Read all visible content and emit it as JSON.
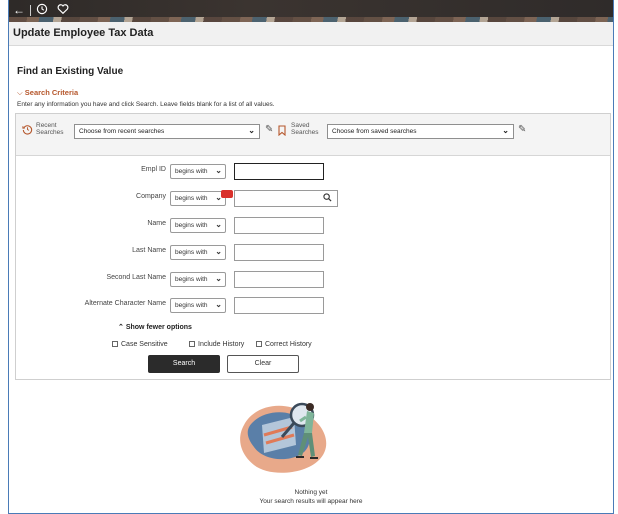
{
  "topbar": {
    "back_icon": "back-arrow-icon",
    "history_icon": "recent-history-icon",
    "favorite_icon": "heart-icon"
  },
  "page": {
    "title": "Update Employee Tax Data",
    "heading": "Find an Existing Value"
  },
  "criteria": {
    "toggle_label": "Search Criteria",
    "instructions": "Enter any information you have and click Search. Leave fields blank for a list of all values."
  },
  "recent": {
    "label_line1": "Recent",
    "label_line2": "Searches",
    "placeholder": "Choose from recent searches"
  },
  "saved": {
    "label_line1": "Saved",
    "label_line2": "Searches",
    "placeholder": "Choose from saved searches"
  },
  "fields": [
    {
      "label": "Empl ID",
      "operator": "begins with",
      "value": ""
    },
    {
      "label": "Company",
      "operator": "begins with",
      "value": ""
    },
    {
      "label": "Name",
      "operator": "begins with",
      "value": ""
    },
    {
      "label": "Last Name",
      "operator": "begins with",
      "value": ""
    },
    {
      "label": "Second Last Name",
      "operator": "begins with",
      "value": ""
    },
    {
      "label": "Alternate Character Name",
      "operator": "begins with",
      "value": ""
    }
  ],
  "options": {
    "toggle_label": "Show fewer options",
    "case_sensitive": "Case Sensitive",
    "include_history": "Include History",
    "correct_history": "Correct History"
  },
  "buttons": {
    "search": "Search",
    "clear": "Clear"
  },
  "empty": {
    "line1": "Nothing yet",
    "line2": "Your search results will appear here"
  },
  "colors": {
    "accent": "#b5562b",
    "primary_button": "#2b2b2b",
    "frame_border": "#4a7bb7"
  }
}
